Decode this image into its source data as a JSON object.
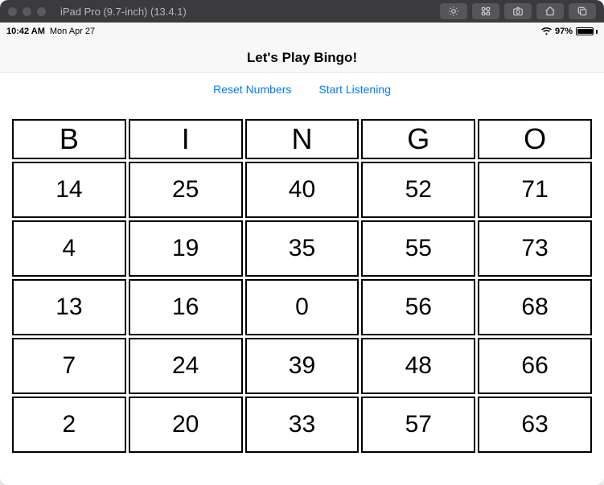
{
  "simulator": {
    "title": "iPad Pro (9.7-inch) (13.4.1)"
  },
  "statusbar": {
    "time": "10:42 AM",
    "date": "Mon Apr 27",
    "battery_pct": "97%"
  },
  "app": {
    "title": "Let's Play Bingo!",
    "reset_label": "Reset Numbers",
    "listen_label": "Start Listening"
  },
  "board": {
    "headers": [
      "B",
      "I",
      "N",
      "G",
      "O"
    ],
    "rows": [
      [
        "14",
        "25",
        "40",
        "52",
        "71"
      ],
      [
        "4",
        "19",
        "35",
        "55",
        "73"
      ],
      [
        "13",
        "16",
        "0",
        "56",
        "68"
      ],
      [
        "7",
        "24",
        "39",
        "48",
        "66"
      ],
      [
        "2",
        "20",
        "33",
        "57",
        "63"
      ]
    ],
    "free_row": 2,
    "free_col": 2
  }
}
